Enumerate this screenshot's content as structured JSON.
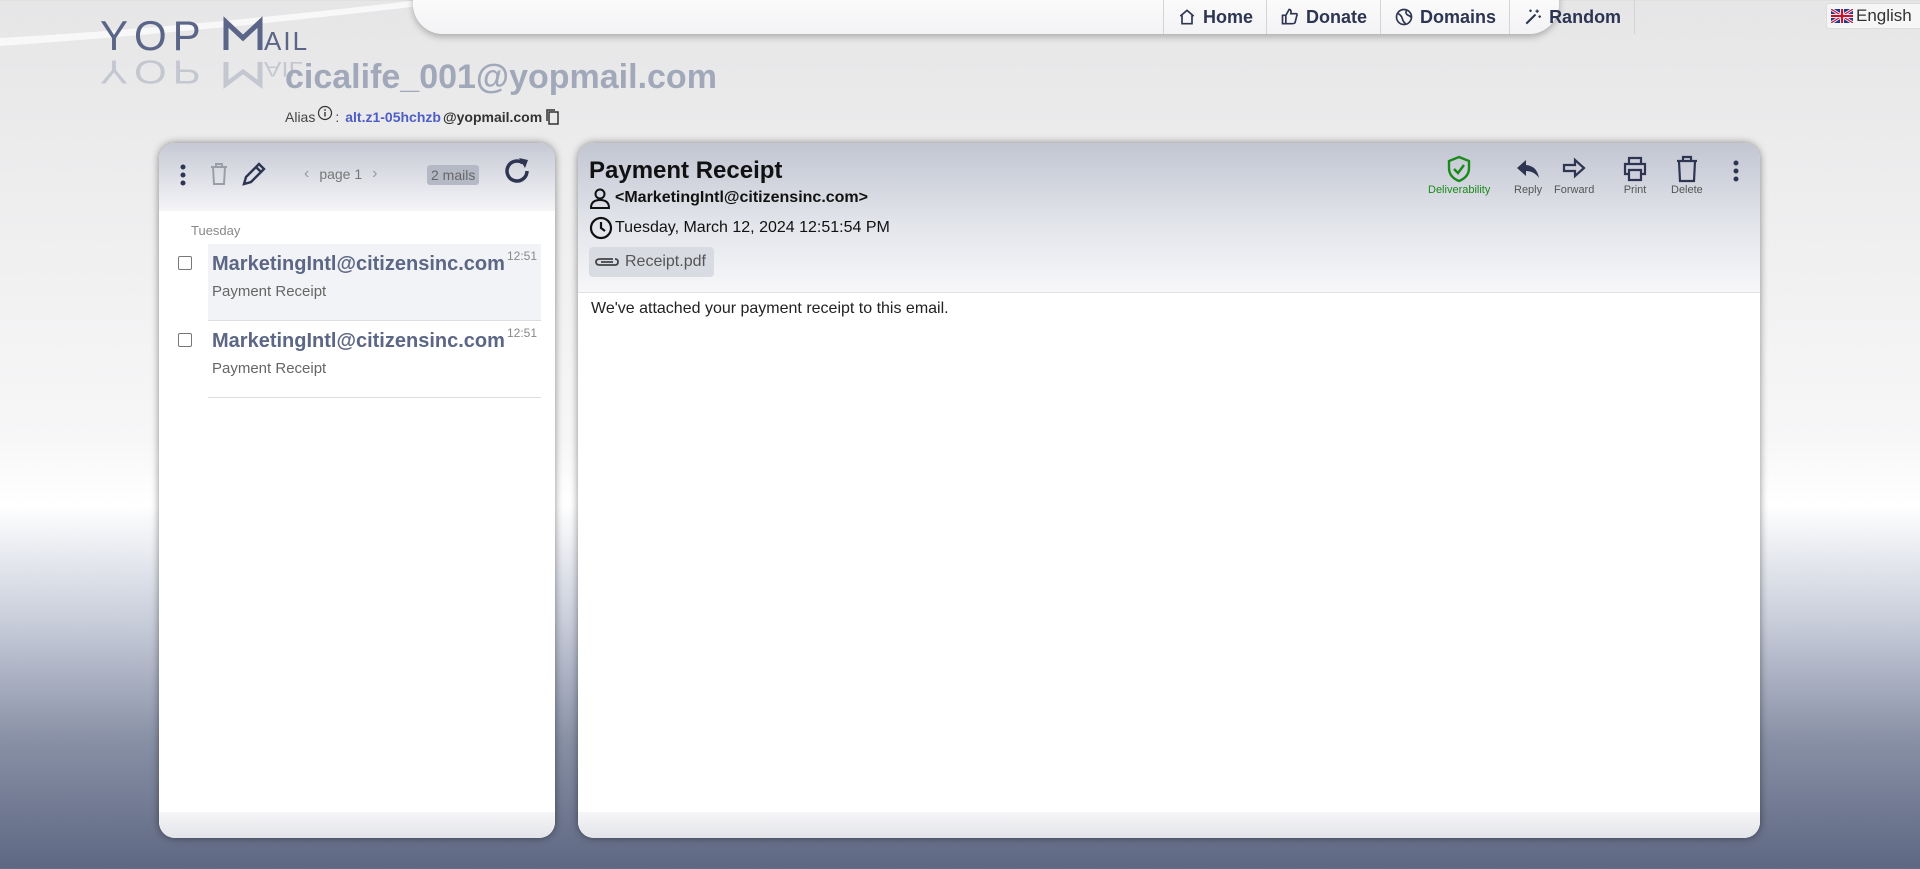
{
  "logo": {
    "text": "YOPMAIL"
  },
  "nav": {
    "links": [
      {
        "label": "Home",
        "icon": "home-icon"
      },
      {
        "label": "Donate",
        "icon": "thumbs-up-icon"
      },
      {
        "label": "Domains",
        "icon": "globe-icon"
      },
      {
        "label": "Random",
        "icon": "magic-wand-icon"
      }
    ],
    "language": "English"
  },
  "inbox": {
    "address": "cicalife_001@yopmail.com",
    "alias_label": "Alias",
    "alias_sep": ":",
    "alias_name": "alt.z1-05hchzb",
    "alias_domain": "@yopmail.com"
  },
  "list": {
    "pager": "page 1",
    "count": "2 mails",
    "day_label": "Tuesday",
    "items": [
      {
        "from": "MarketingIntl@citizensinc.com",
        "time": "12:51",
        "subject": "Payment Receipt"
      },
      {
        "from": "MarketingIntl@citizensinc.com",
        "time": "12:51",
        "subject": "Payment Receipt"
      }
    ]
  },
  "mail": {
    "subject": "Payment Receipt",
    "from": "<MarketingIntl@citizensinc.com>",
    "date": "Tuesday, March 12, 2024 12:51:54 PM",
    "attachment": "Receipt.pdf",
    "body": "We've attached your payment receipt to this email.",
    "actions": {
      "deliverability": "Deliverability",
      "reply": "Reply",
      "forward": "Forward",
      "print": "Print",
      "delete": "Delete"
    }
  },
  "colors": {
    "brand_navy": "#2d3552",
    "address_gray": "#a0a8ba",
    "alias_blue": "#4d5ec6",
    "deliverability_green": "#1a8a1a"
  }
}
